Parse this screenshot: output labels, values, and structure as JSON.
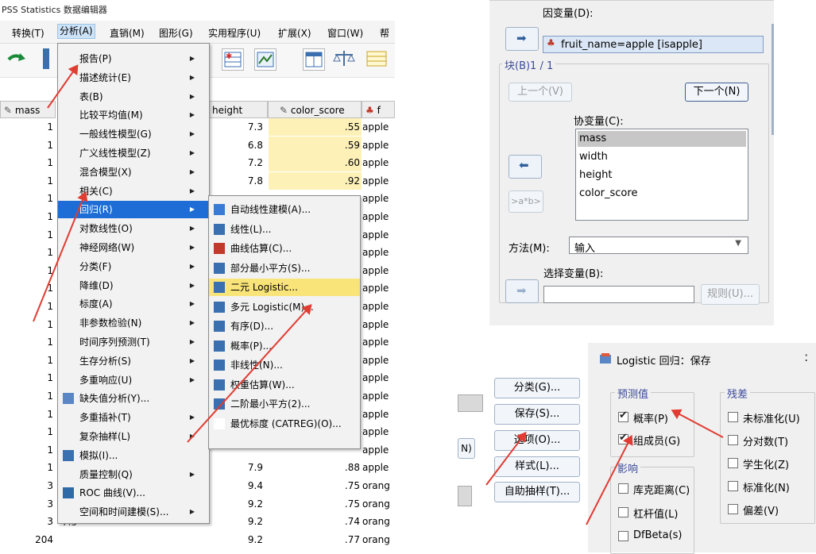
{
  "spss": {
    "title": "PSS Statistics 数据编辑器",
    "menubar": [
      "转换(T)",
      "分析(A)",
      "直销(M)",
      "图形(G)",
      "实用程序(U)",
      "扩展(X)",
      "窗口(W)",
      "帮"
    ],
    "columns": {
      "mass": "mass",
      "height": "height",
      "color_score": "color_score",
      "fruit": "f"
    },
    "mass_rows": [
      "1",
      "1",
      "1",
      "1",
      "1",
      "1",
      "1",
      "1",
      "1",
      "1",
      "1",
      "1",
      "1",
      "1",
      "1",
      "1",
      "1",
      "1",
      "1",
      "1",
      "3",
      "3",
      "3",
      "204"
    ],
    "height_rows": [
      "7.3",
      "6.8",
      "7.2",
      "7.8",
      "",
      "",
      "",
      "",
      "",
      "",
      "",
      "",
      "",
      "",
      "",
      "",
      "",
      "",
      "",
      "7.9",
      "9.4",
      "9.2",
      "9.2",
      "9.2"
    ],
    "color_rows": [
      ".55",
      ".59",
      ".60",
      ".92",
      "",
      "",
      "",
      "",
      "",
      "",
      "",
      "",
      "",
      "",
      "",
      "",
      "",
      "",
      "",
      ".88",
      ".75",
      ".75",
      ".74",
      ".77"
    ],
    "fruit_rows": [
      "apple",
      "apple",
      "apple",
      "apple",
      "apple",
      "apple",
      "apple",
      "apple",
      "apple",
      "apple",
      "apple",
      "apple",
      "apple",
      "apple",
      "apple",
      "apple",
      "apple",
      "apple",
      "apple",
      "apple",
      "orang",
      "orang",
      "orang",
      "orang"
    ],
    "last_mass_extra": "7.5"
  },
  "analyze_menu": {
    "items": [
      {
        "label": "报告(P)",
        "arrow": true
      },
      {
        "label": "描述统计(E)",
        "arrow": true
      },
      {
        "label": "表(B)",
        "arrow": true
      },
      {
        "label": "比较平均值(M)",
        "arrow": true
      },
      {
        "label": "一般线性模型(G)",
        "arrow": true
      },
      {
        "label": "广义线性模型(Z)",
        "arrow": true
      },
      {
        "label": "混合模型(X)",
        "arrow": true
      },
      {
        "label": "相关(C)",
        "arrow": true
      },
      {
        "label": "回归(R)",
        "arrow": true
      },
      {
        "label": "对数线性(O)",
        "arrow": true
      },
      {
        "label": "神经网络(W)",
        "arrow": true
      },
      {
        "label": "分类(F)",
        "arrow": true
      },
      {
        "label": "降维(D)",
        "arrow": true
      },
      {
        "label": "标度(A)",
        "arrow": true
      },
      {
        "label": "非参数检验(N)",
        "arrow": true
      },
      {
        "label": "时间序列预测(T)",
        "arrow": true
      },
      {
        "label": "生存分析(S)",
        "arrow": true
      },
      {
        "label": "多重响应(U)",
        "arrow": true
      },
      {
        "label": "缺失值分析(Y)...",
        "arrow": false
      },
      {
        "label": "多重插补(T)",
        "arrow": true
      },
      {
        "label": "复杂抽样(L)",
        "arrow": true
      },
      {
        "label": "模拟(I)...",
        "arrow": false
      },
      {
        "label": "质量控制(Q)",
        "arrow": true
      },
      {
        "label": "ROC 曲线(V)...",
        "arrow": false
      },
      {
        "label": "空间和时间建模(S)...",
        "arrow": true
      }
    ]
  },
  "regression_menu": {
    "items": [
      {
        "label": "自动线性建模(A)..."
      },
      {
        "label": "线性(L)..."
      },
      {
        "label": "曲线估算(C)..."
      },
      {
        "label": "部分最小平方(S)..."
      },
      {
        "label": "二元 Logistic..."
      },
      {
        "label": "多元 Logistic(M)..."
      },
      {
        "label": "有序(D)..."
      },
      {
        "label": "概率(P)..."
      },
      {
        "label": "非线性(N)..."
      },
      {
        "label": "权重估算(W)..."
      },
      {
        "label": "二阶最小平方(2)..."
      },
      {
        "label": "最优标度 (CATREG)(O)..."
      }
    ]
  },
  "logistic_dialog": {
    "dependent_label": "因变量(D):",
    "dependent_value": "fruit_name=apple [isapple]",
    "block_label": "块(B)1 / 1",
    "prev_button": "上一个(V)",
    "next_button": "下一个(N)",
    "covariates_label": "协变量(C):",
    "covariates": [
      "mass",
      "width",
      "height",
      "color_score"
    ],
    "interaction_button": ">a*b>",
    "method_label": "方法(M):",
    "method_value": "输入",
    "selection_label": "选择变量(B):",
    "rule_button": "规则(U)..."
  },
  "side_buttons": [
    "分类(G)...",
    "保存(S)...",
    "选项(O)...",
    "样式(L)...",
    "自助抽样(T)..."
  ],
  "partial_button": "N)",
  "save_dialog": {
    "title": "Logistic 回归：保存",
    "predicted_group": "预测值",
    "predicted": [
      {
        "label": "概率(P)",
        "checked": true
      },
      {
        "label": "组成员(G)",
        "checked": true
      }
    ],
    "influence_group": "影响",
    "influence": [
      {
        "label": "库克距离(C)",
        "checked": false
      },
      {
        "label": "杠杆值(L)",
        "checked": false
      },
      {
        "label": "DfBeta(s)",
        "checked": false
      }
    ],
    "residuals_group": "残差",
    "residuals": [
      {
        "label": "未标准化(U)",
        "checked": false
      },
      {
        "label": "分对数(T)",
        "checked": false
      },
      {
        "label": "学生化(Z)",
        "checked": false
      },
      {
        "label": "标准化(N)",
        "checked": false
      },
      {
        "label": "偏差(V)",
        "checked": false
      }
    ]
  },
  "colors": {
    "highlight": "#1e6dd6",
    "yellow": "#f9e47a",
    "arrow": "#e03c32"
  }
}
